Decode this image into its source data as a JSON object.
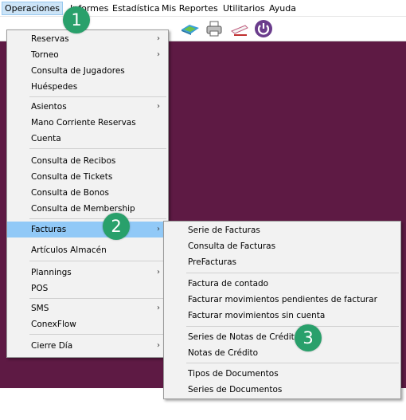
{
  "menubar": {
    "items": [
      "Operaciones",
      "Informes",
      "Estadística",
      "Mis Reportes",
      "Utilitarios",
      "Ayuda"
    ]
  },
  "toolbar": {
    "icons": [
      "map-icon",
      "printer-icon",
      "pen-icon",
      "power-icon"
    ]
  },
  "main_menu": {
    "items": [
      "Reservas",
      "Torneo",
      "Consulta de Jugadores",
      "Huéspedes",
      "Asientos",
      "Mano Corriente Reservas",
      "Cuenta",
      "Consulta de Recibos",
      "Consulta de Tickets",
      "Consulta de Bonos",
      "Consulta de Membership",
      "Facturas",
      "Artículos Almacén",
      "Plannings",
      "POS",
      "SMS",
      "ConexFlow",
      "Cierre Día"
    ],
    "arrow": "›"
  },
  "facturas_submenu": {
    "items": [
      "Serie de Facturas",
      "Consulta de Facturas",
      "PreFacturas",
      "Factura de contado",
      "Facturar movimientos pendientes de facturar",
      "Facturar movimientos sin cuenta",
      "Series de Notas de Crédito",
      "Notas de Crédito",
      "Tipos de Documentos",
      "Series de Documentos"
    ]
  },
  "badges": [
    "1",
    "2",
    "3"
  ],
  "colors": {
    "workspace": "#5e1a44",
    "badge": "#29a06b",
    "highlight": "#91c9f7"
  }
}
